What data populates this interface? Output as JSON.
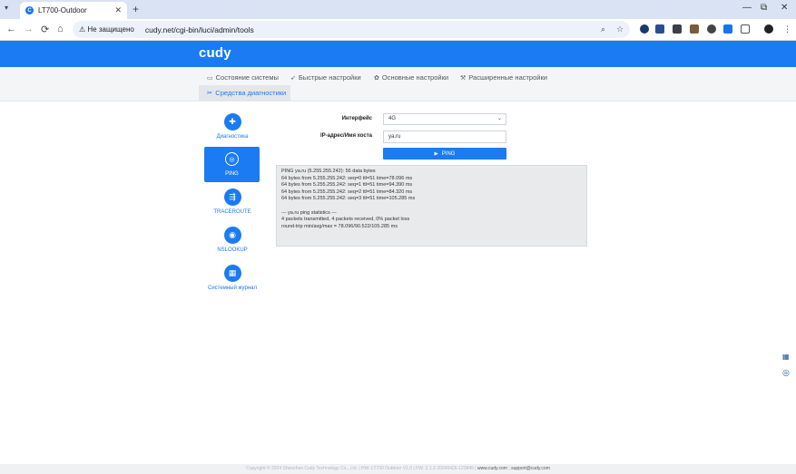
{
  "browser": {
    "tab_title": "LT700-Outdoor",
    "tab_close": "✕",
    "new_tab": "+",
    "menu_arrow": "▾",
    "security_label": "Не защищено",
    "url": "cudy.net/cgi-bin/luci/admin/tools",
    "window_controls": [
      "—",
      "⧉",
      "✕"
    ],
    "nav": {
      "back": "←",
      "forward": "→",
      "reload": "⟳",
      "home": "⌂"
    }
  },
  "brand": {
    "logo": "cudy",
    "accent": "#1a7bf2"
  },
  "menu": {
    "items": [
      {
        "label": "Состояние системы",
        "icon": "monitor-icon"
      },
      {
        "label": "Быстрые настройки",
        "icon": "rocket-icon"
      },
      {
        "label": "Основные настройки",
        "icon": "gear-icon"
      },
      {
        "label": "Расширенные настройки",
        "icon": "wrench-gear-icon"
      }
    ],
    "active": {
      "label": "Средства диагностики",
      "icon": "tools-icon"
    }
  },
  "sidebar": {
    "items": [
      {
        "label": "Диагностика",
        "icon": "medkit-icon"
      },
      {
        "label": "PING",
        "icon": "target-icon",
        "active": true
      },
      {
        "label": "TRACEROUTE",
        "icon": "route-icon"
      },
      {
        "label": "NSLOOKUP",
        "icon": "lookup-icon"
      },
      {
        "label": "Системный журнал",
        "icon": "log-icon"
      }
    ]
  },
  "form": {
    "interface_label": "Интерфейс",
    "interface_value": "4G",
    "host_label": "IP-адрес/Имя хоста",
    "host_value": "ya.ru",
    "ping_button": "PING"
  },
  "output": {
    "lines": [
      "PING ya.ru (5.255.255.242): 56 data bytes",
      "64 bytes from 5.255.255.242: seq=0 ttl=51 time=78.096 ms",
      "64 bytes from 5.255.255.242: seq=1 ttl=51 time=94.390 ms",
      "64 bytes from 5.255.255.242: seq=2 ttl=51 time=84.320 ms",
      "64 bytes from 5.255.255.242: seq=3 ttl=51 time=105.285 ms",
      "",
      "--- ya.ru ping statistics ---",
      "4 packets transmitted, 4 packets received, 0% packet loss",
      "round-trip min/avg/max = 78.096/90.522/105.285 ms"
    ]
  },
  "footer": {
    "text": "Copyright © 2024 Shenzhen Cudy Technology Co., Ltd.  |  HW: LT700 Outdoor V1.0  |  FW: 2.1.3-20240426-123845  |",
    "link1": "www.cudy.com",
    "separator": "|",
    "link2": "support@cudy.com"
  }
}
